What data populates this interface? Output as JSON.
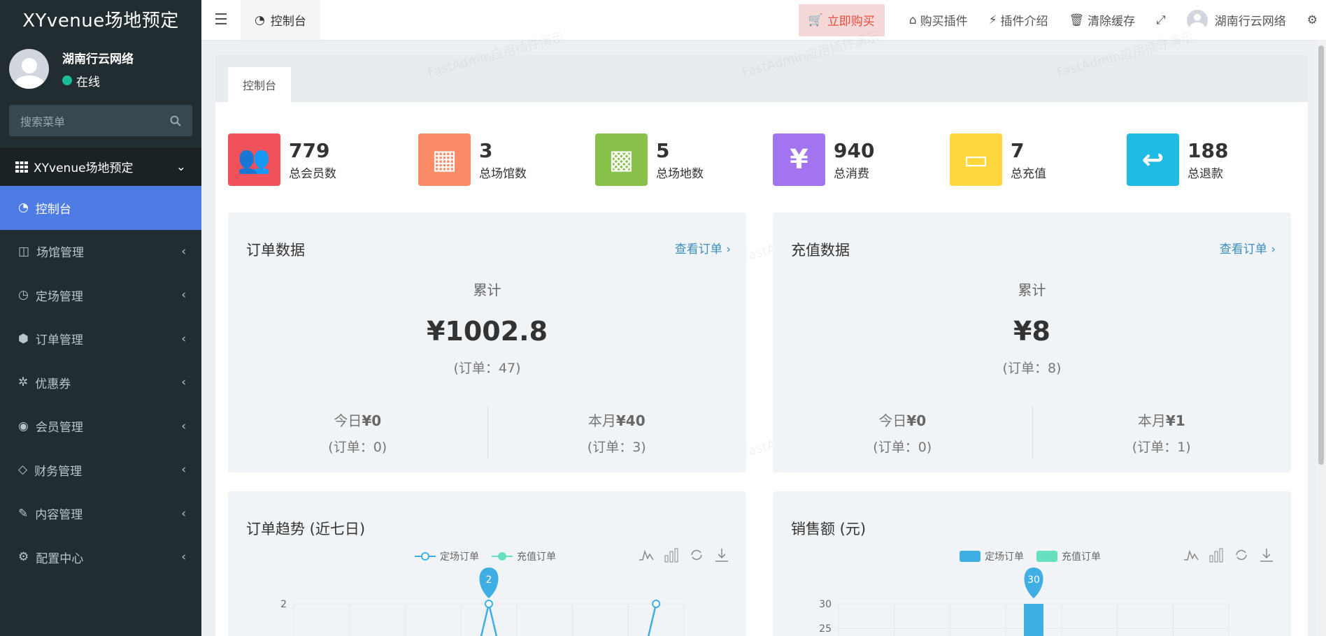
{
  "sidebar": {
    "brand": "XYvenue场地预定",
    "user": {
      "name": "湖南行云网络",
      "status": "在线"
    },
    "search_placeholder": "搜索菜单",
    "menu_header": "XYvenue场地预定",
    "items": [
      {
        "label": "控制台",
        "icon": "dashboard-icon",
        "active": true
      },
      {
        "label": "场馆管理",
        "icon": "columns-icon"
      },
      {
        "label": "定场管理",
        "icon": "clock-icon"
      },
      {
        "label": "订单管理",
        "icon": "cube-icon"
      },
      {
        "label": "优惠券",
        "icon": "ticket-icon"
      },
      {
        "label": "会员管理",
        "icon": "user-circle-icon"
      },
      {
        "label": "财务管理",
        "icon": "diamond-icon"
      },
      {
        "label": "内容管理",
        "icon": "edit-icon"
      },
      {
        "label": "配置中心",
        "icon": "gear-icon"
      }
    ]
  },
  "topbar": {
    "tab_label": "控制台",
    "buy_label": "立即购买",
    "links": [
      "购买插件",
      "插件介绍",
      "清除缓存"
    ],
    "user_name": "湖南行云网络"
  },
  "content": {
    "tab": "控制台",
    "stats": [
      {
        "value": "779",
        "label": "总会员数",
        "color": "#f0525c",
        "icon": "users-icon"
      },
      {
        "value": "3",
        "label": "总场馆数",
        "color": "#fb8b67",
        "icon": "grid-4-icon"
      },
      {
        "value": "5",
        "label": "总场地数",
        "color": "#89c24b",
        "icon": "grid-9-icon"
      },
      {
        "value": "940",
        "label": "总消费",
        "color": "#a274f0",
        "icon": "yen-icon"
      },
      {
        "value": "7",
        "label": "总充值",
        "color": "#fed73e",
        "icon": "archive-icon"
      },
      {
        "value": "188",
        "label": "总退款",
        "color": "#1fbbe4",
        "icon": "reply-icon"
      }
    ],
    "order_card": {
      "title": "订单数据",
      "link": "查看订单",
      "cum_label": "累计",
      "total": "¥1002.8",
      "total_orders": "(订单：47)",
      "today_label": "今日",
      "today_value": "¥0",
      "today_orders": "(订单：0)",
      "month_label": "本月",
      "month_value": "¥40",
      "month_orders": "(订单：3)"
    },
    "recharge_card": {
      "title": "充值数据",
      "link": "查看订单",
      "cum_label": "累计",
      "total": "¥8",
      "total_orders": "(订单：8)",
      "today_label": "今日",
      "today_value": "¥0",
      "today_orders": "(订单：0)",
      "month_label": "本月",
      "month_value": "¥1",
      "month_orders": "(订单：1)"
    },
    "trend_card": {
      "title": "订单趋势 (近七日)",
      "legend": [
        "定场订单",
        "充值订单"
      ]
    },
    "sales_card": {
      "title": "销售额 (元)",
      "legend": [
        "定场订单",
        "充值订单"
      ]
    },
    "watermark": "FastAdmin应用插件演示"
  },
  "chart_data": [
    {
      "type": "line",
      "title": "订单趋势 (近七日)",
      "series": [
        {
          "name": "定场订单",
          "visible_points": [
            {
              "y": 2
            },
            {
              "y": 2
            }
          ]
        },
        {
          "name": "充值订单",
          "values": []
        }
      ],
      "y_ticks": [
        2
      ],
      "marker_label": "2"
    },
    {
      "type": "bar",
      "title": "销售额 (元)",
      "series": [
        {
          "name": "定场订单",
          "visible_values": [
            30
          ]
        },
        {
          "name": "充值订单",
          "values": []
        }
      ],
      "y_ticks": [
        25,
        30
      ],
      "marker_label": "30"
    }
  ]
}
